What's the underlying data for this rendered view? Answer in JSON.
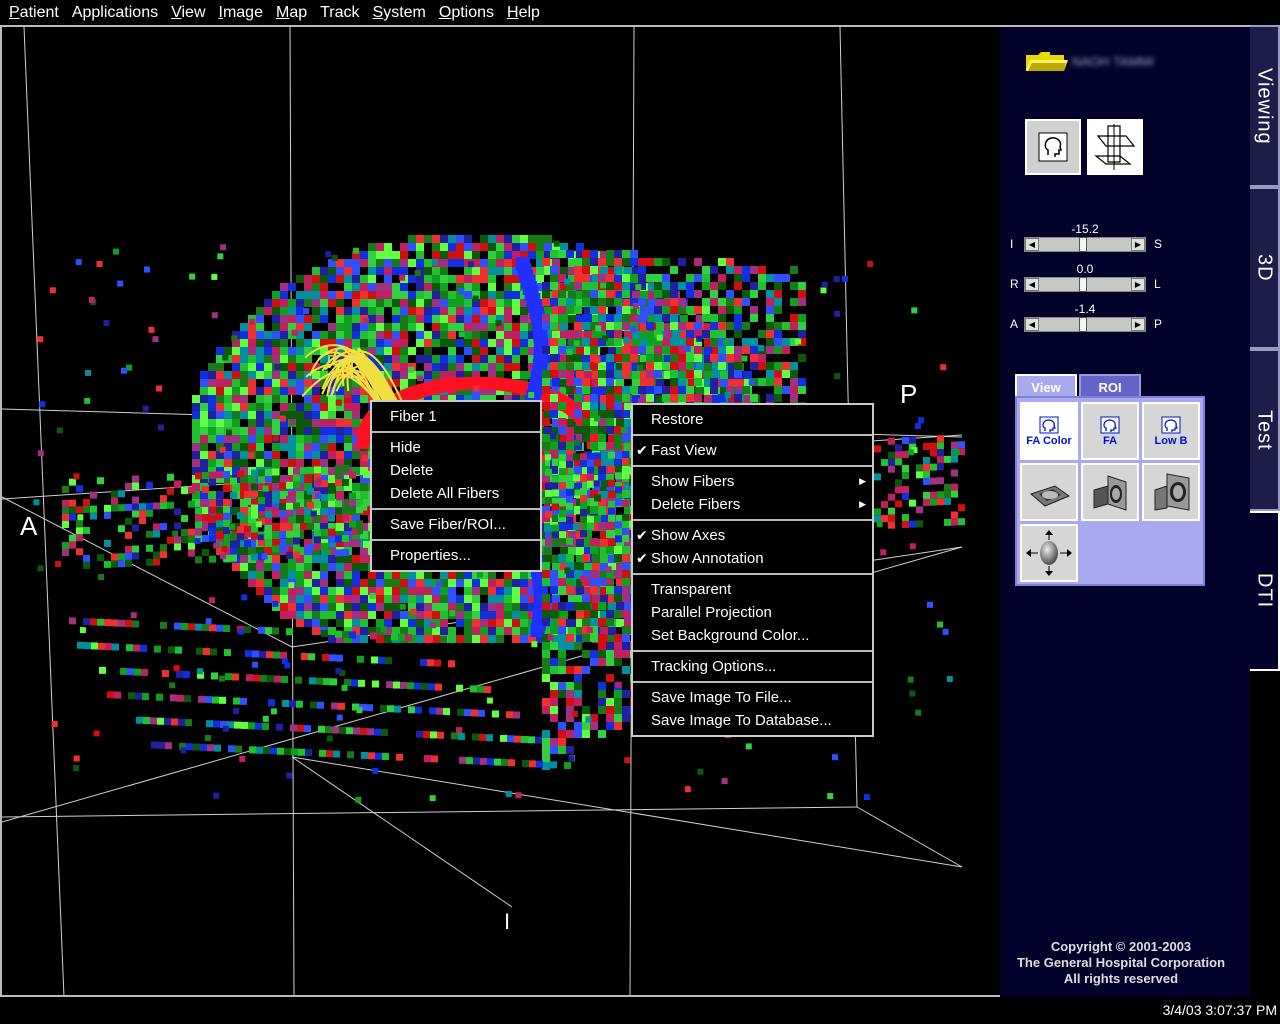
{
  "menubar": {
    "items": [
      {
        "mn": "P",
        "rest": "atient"
      },
      {
        "mn": "",
        "rest": "Applications"
      },
      {
        "mn": "V",
        "rest": "iew"
      },
      {
        "mn": "I",
        "rest": "mage"
      },
      {
        "mn": "M",
        "rest": "ap"
      },
      {
        "mn": "",
        "rest": "Track"
      },
      {
        "mn": "S",
        "rest": "ystem"
      },
      {
        "mn": "O",
        "rest": "ptions"
      },
      {
        "mn": "H",
        "rest": "elp"
      }
    ]
  },
  "viewport": {
    "axis_labels": {
      "anterior": "A",
      "posterior": "P",
      "inferior": "I"
    }
  },
  "fiber_menu": {
    "title": "Fiber 1",
    "hide": "Hide",
    "delete": "Delete",
    "delete_all": "Delete All Fibers",
    "save": "Save Fiber/ROI...",
    "properties": "Properties..."
  },
  "view_menu": {
    "restore": "Restore",
    "fast_view": "Fast View",
    "show_fibers": "Show Fibers",
    "delete_fibers": "Delete Fibers",
    "show_axes": "Show Axes",
    "show_annotation": "Show Annotation",
    "transparent": "Transparent",
    "parallel_projection": "Parallel Projection",
    "set_background": "Set Background Color...",
    "tracking_options": "Tracking Options...",
    "save_file": "Save Image To File...",
    "save_db": "Save Image To Database...",
    "check_glyph": "✔",
    "submenu_glyph": "▶"
  },
  "panel": {
    "patient_name": "NAOH TAMMI",
    "sliders": [
      {
        "value": "-15.2",
        "left": "I",
        "right": "S",
        "fraction": 0.48
      },
      {
        "value": "0.0",
        "left": "R",
        "right": "L",
        "fraction": 0.48
      },
      {
        "value": "-1.4",
        "left": "A",
        "right": "P",
        "fraction": 0.48
      }
    ],
    "subtabs": {
      "view": "View",
      "roi": "ROI"
    },
    "view_buttons": {
      "fa_color": "FA Color",
      "fa": "FA",
      "low_b": "Low B"
    },
    "copyright": {
      "line1": "Copyright © 2001-2003",
      "line2": "The General Hospital Corporation",
      "line3": "All rights reserved"
    }
  },
  "side_tabs": {
    "viewing": "Viewing",
    "three_d": "3D",
    "test": "Test",
    "dti": "DTI"
  },
  "colors": {
    "accent": "#8080ff",
    "panel_bg": "#02022a",
    "folder": "#f0e000",
    "fa_label": "#0010d0"
  },
  "status": {
    "clock": "3/4/03 3:07:37 PM"
  }
}
